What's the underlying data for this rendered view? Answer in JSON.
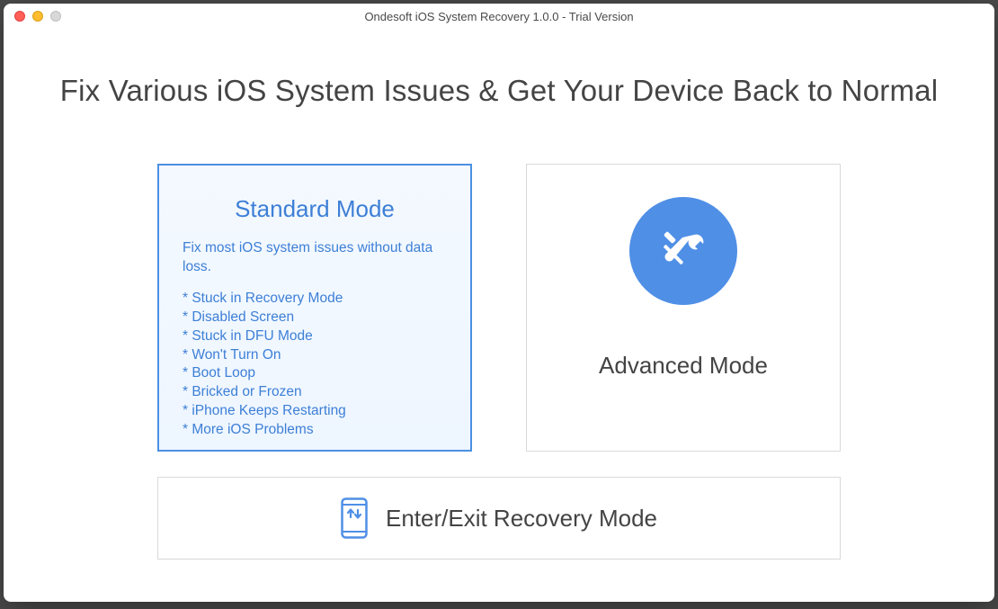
{
  "window": {
    "title": "Ondesoft iOS System Recovery 1.0.0 - Trial Version"
  },
  "headline": "Fix Various iOS System Issues & Get Your Device Back to Normal",
  "standard": {
    "title": "Standard Mode",
    "subtitle": "Fix most iOS system issues without data loss.",
    "items": [
      "* Stuck in Recovery Mode",
      "* Disabled Screen",
      "* Stuck in DFU Mode",
      "* Won't Turn On",
      "* Boot Loop",
      "* Bricked or Frozen",
      "* iPhone Keeps Restarting",
      "* More iOS Problems"
    ]
  },
  "advanced": {
    "title": "Advanced Mode"
  },
  "recovery": {
    "title": "Enter/Exit Recovery Mode"
  },
  "colors": {
    "accent": "#4f8fe6",
    "text": "#444444"
  }
}
